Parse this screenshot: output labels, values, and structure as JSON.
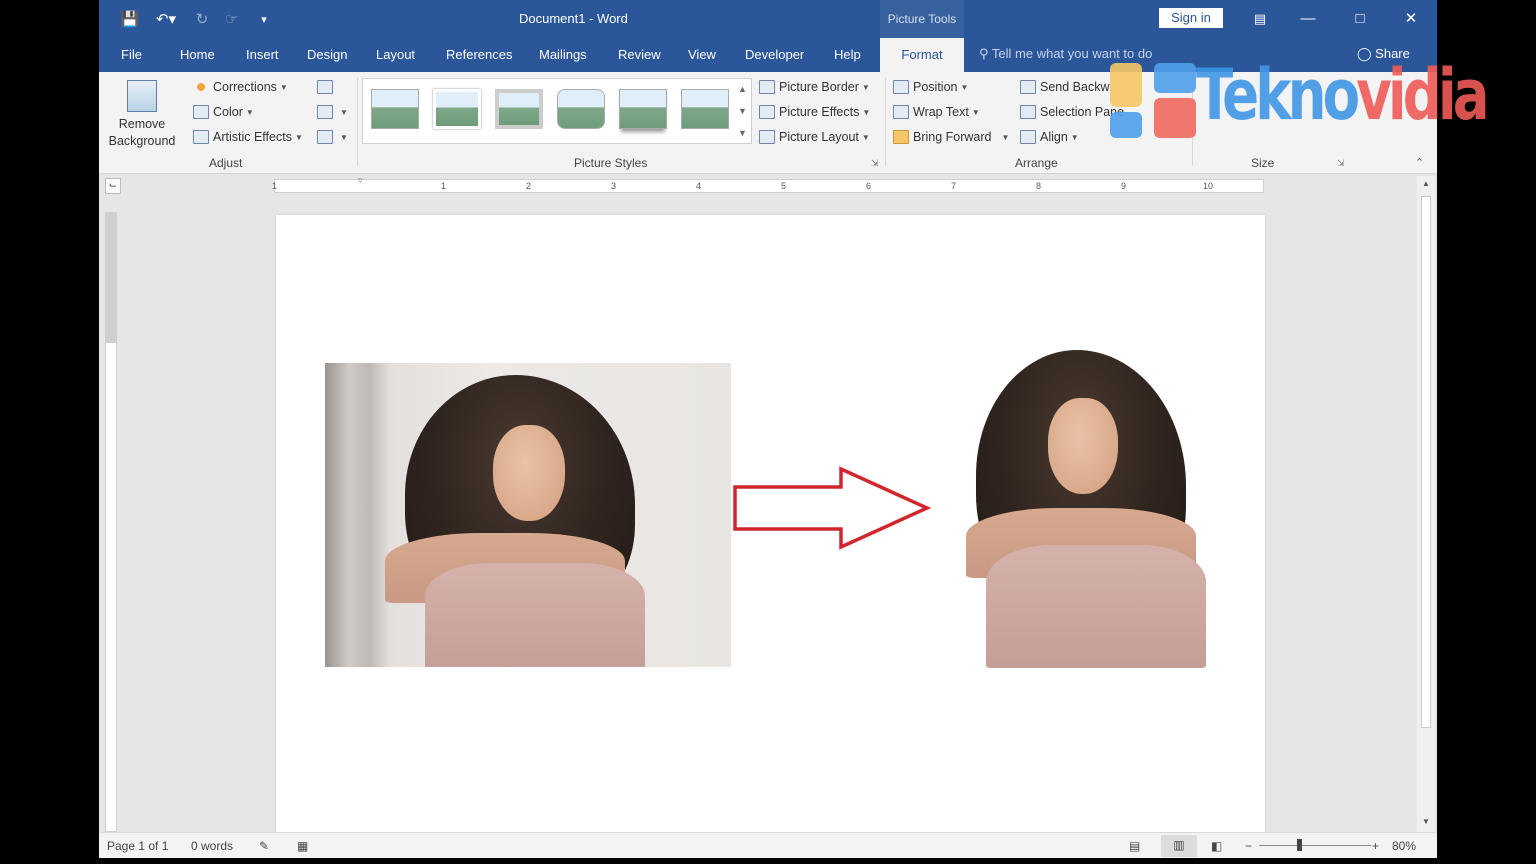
{
  "titlebar": {
    "document_title": "Document1  -  Word",
    "context_group": "Picture Tools",
    "sign_in": "Sign in"
  },
  "tabs": [
    "File",
    "Home",
    "Insert",
    "Design",
    "Layout",
    "References",
    "Mailings",
    "Review",
    "View",
    "Developer",
    "Help"
  ],
  "active_tab": "Format",
  "tell_me": "Tell me what you want to do",
  "share": "Share",
  "ribbon": {
    "adjust": {
      "remove_background_line1": "Remove",
      "remove_background_line2": "Background",
      "corrections": "Corrections",
      "color": "Color",
      "artistic_effects": "Artistic Effects",
      "label": "Adjust"
    },
    "picture_styles": {
      "picture_border": "Picture Border",
      "picture_effects": "Picture Effects",
      "picture_layout": "Picture Layout",
      "label": "Picture Styles"
    },
    "arrange": {
      "position": "Position",
      "wrap_text": "Wrap Text",
      "bring_forward": "Bring Forward",
      "send_backward": "Send Backw",
      "selection_pane": "Selection Pane",
      "align": "Align",
      "label": "Arrange"
    },
    "size": {
      "label": "Size"
    }
  },
  "ruler": {
    "labels": [
      "1",
      "1",
      "2",
      "3",
      "4",
      "5",
      "6",
      "7",
      "8",
      "9",
      "10"
    ]
  },
  "statusbar": {
    "page": "Page 1 of 1",
    "words": "0 words",
    "zoom": "80%"
  },
  "watermark": {
    "text_blue": "Tekno",
    "text_red": "vidia"
  },
  "colors": {
    "title_blue": "#2b579a",
    "ribbon_bg": "#f3f3f3",
    "arrow_red": "#d0262d"
  }
}
